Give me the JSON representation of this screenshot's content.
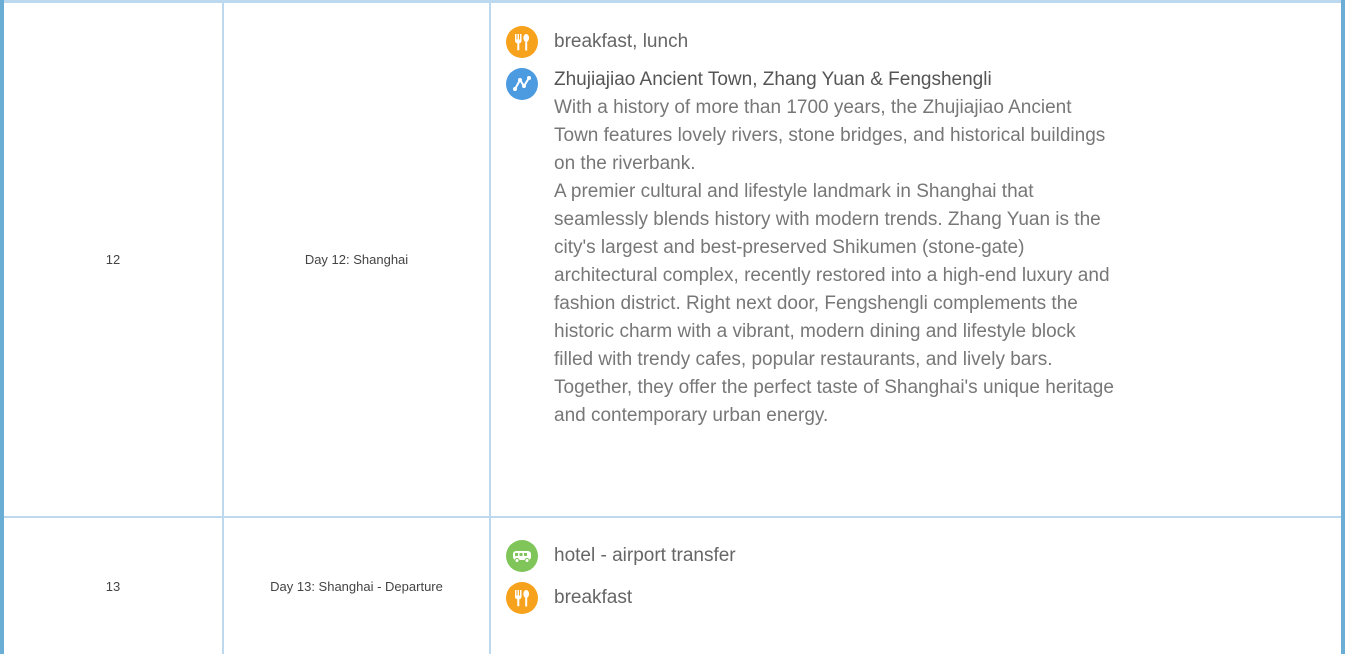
{
  "itinerary": [
    {
      "number": "12",
      "day": "Day 12: Shanghai",
      "meals": "breakfast, lunch",
      "attraction": {
        "title": "Zhujiajiao Ancient Town, Zhang Yuan & Fengshengli",
        "paragraphs": [
          "With a history of more than 1700 years, the Zhujiajiao Ancient Town features lovely rivers, stone bridges, and historical buildings on the riverbank.",
          "A premier cultural and lifestyle landmark in Shanghai that seamlessly blends history with modern trends. Zhang Yuan is the city's largest and best-preserved Shikumen (stone-gate) architectural complex, recently restored into a high-end luxury and fashion district. Right next door, Fengshengli complements the historic charm with a vibrant, modern dining and lifestyle block filled with trendy cafes, popular restaurants, and lively bars. Together, they offer the perfect taste of Shanghai's unique heritage and contemporary urban energy."
        ]
      }
    },
    {
      "number": "13",
      "day": "Day 13: Shanghai - Departure",
      "transfer": "hotel - airport transfer",
      "meals": "breakfast"
    }
  ],
  "icons": {
    "meal": "fork-spoon-icon",
    "attraction": "route-icon",
    "transfer": "bus-icon"
  },
  "colors": {
    "meal": "#f6a21c",
    "attraction": "#4c9be0",
    "transfer": "#7fc55a",
    "border": "#bcd9ef",
    "frame": "#6aaed6"
  }
}
